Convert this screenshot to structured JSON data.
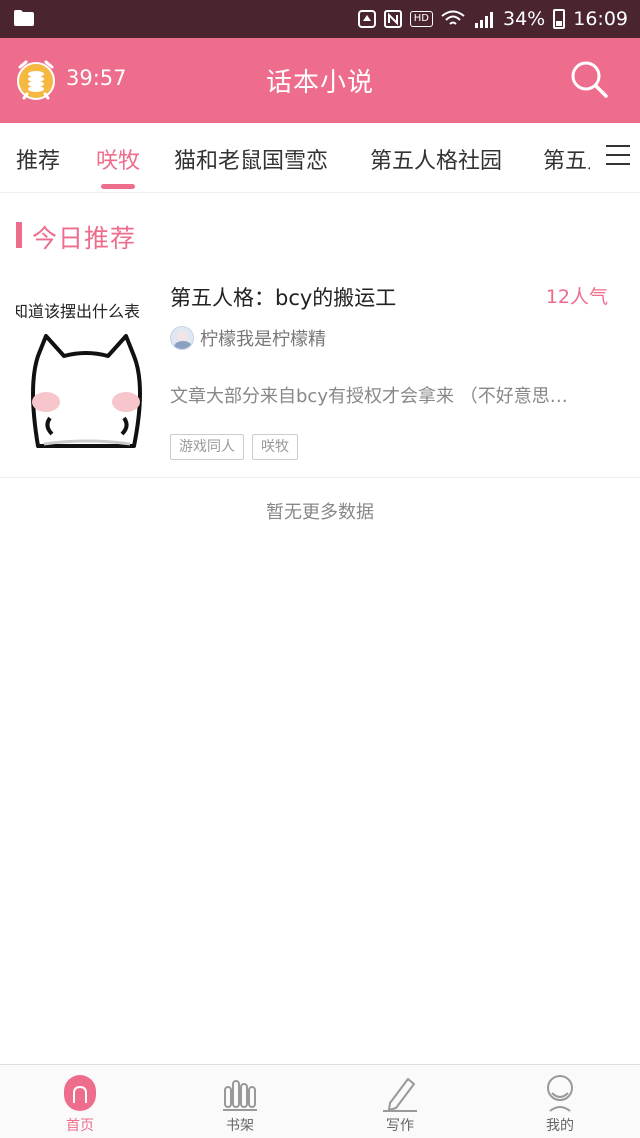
{
  "status_bar": {
    "battery": "34%",
    "time": "16:09",
    "hd_label": "HD"
  },
  "header": {
    "timer": "39:57",
    "title": "话本小说",
    "icons": {
      "timer": "coin-clock-icon",
      "search": "search-icon"
    }
  },
  "tabs": [
    {
      "label": "推荐",
      "active": false
    },
    {
      "label": "咲牧",
      "active": true
    },
    {
      "label": "猫和老鼠国雪恋",
      "active": false
    },
    {
      "label": "第五人格社园",
      "active": false
    },
    {
      "label": "第五人",
      "active": false
    }
  ],
  "section": {
    "title": "今日推荐"
  },
  "books": [
    {
      "cover_caption": "知道该摆出什么表",
      "title": "第五人格：bcy的搬运工",
      "popularity": "12人气",
      "author": "柠檬我是柠檬精",
      "summary": "文章大部分来自bcy有授权才会拿来 （不好意思…",
      "tags": [
        "游戏同人",
        "咲牧"
      ]
    }
  ],
  "footer_message": "暂无更多数据",
  "bottom_nav": [
    {
      "label": "首页",
      "icon": "home-icon",
      "active": true
    },
    {
      "label": "书架",
      "icon": "bookshelf-icon",
      "active": false
    },
    {
      "label": "写作",
      "icon": "pen-icon",
      "active": false
    },
    {
      "label": "我的",
      "icon": "profile-icon",
      "active": false
    }
  ],
  "colors": {
    "accent": "#ee6d8d",
    "status_bar": "#4a2530"
  }
}
